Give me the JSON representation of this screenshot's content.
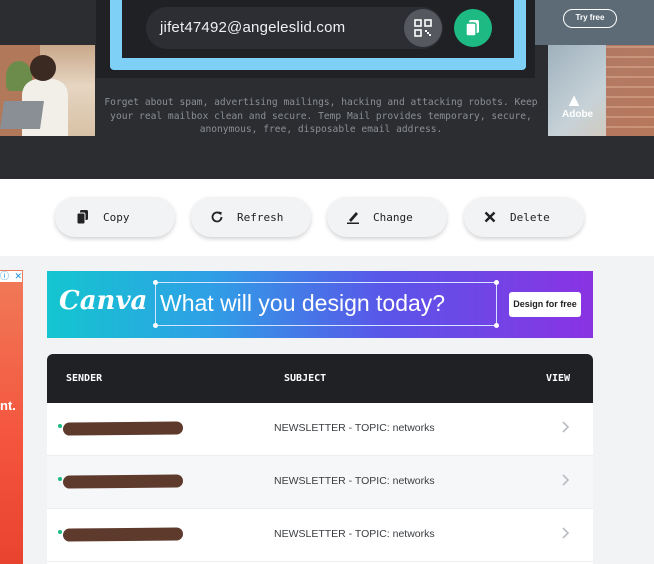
{
  "header": {
    "email": "jifet47492@angeleslid.com",
    "description": "Forget about spam, advertising mailings, hacking and attacking robots. Keep your real mailbox clean and secure. Temp Mail provides temporary, secure, anonymous, free, disposable email address.",
    "try_free_label": "Try free",
    "right_ad_brand": "Adobe",
    "highlight_color": "#7fd0f6",
    "accent_color": "#1dbb83"
  },
  "actions": {
    "copy_label": "Copy",
    "refresh_label": "Refresh",
    "change_label": "Change",
    "delete_label": "Delete"
  },
  "banner": {
    "brand": "Canva",
    "tagline": "What will you design today?",
    "cta": "Design for free"
  },
  "side_ad": {
    "partial_text": "nt."
  },
  "inbox": {
    "columns": [
      "SENDER",
      "SUBJECT",
      "VIEW"
    ],
    "rows": [
      {
        "sender": "",
        "subject": "NEWSLETTER - TOPIC: networks"
      },
      {
        "sender": "",
        "subject": "NEWSLETTER - TOPIC: networks"
      },
      {
        "sender": "",
        "subject": "NEWSLETTER - TOPIC: networks"
      }
    ]
  }
}
